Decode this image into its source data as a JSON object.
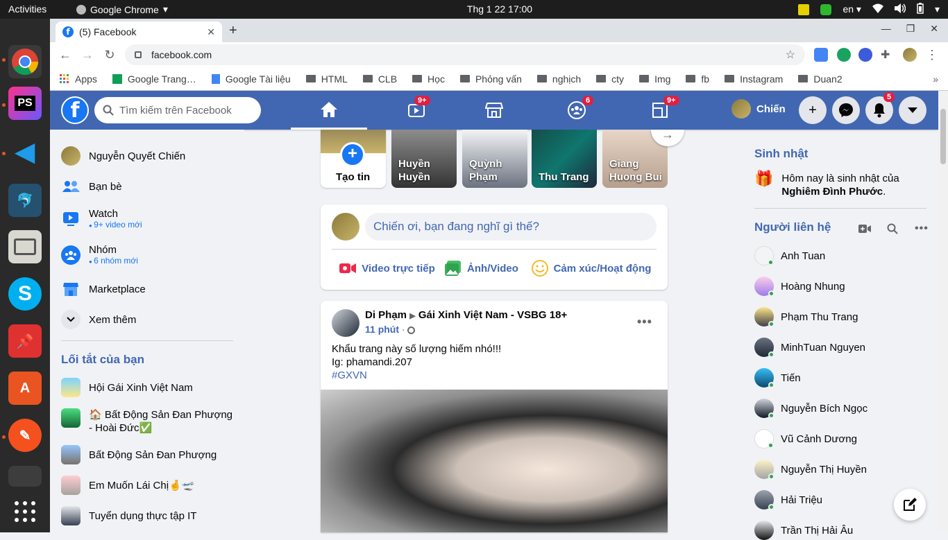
{
  "gnome": {
    "activities": "Activities",
    "app": "Google Chrome",
    "clock": "Thg 1 22  17:00",
    "lang": "en"
  },
  "browser": {
    "tab_title": "(5) Facebook",
    "url": "facebook.com",
    "bookmarks": [
      "Apps",
      "Google Trang…",
      "Google Tài liệu",
      "HTML",
      "CLB",
      "Học",
      "Phỏng vấn",
      "nghịch",
      "cty",
      "Img",
      "fb",
      "Instagram",
      "Duan2"
    ]
  },
  "fb": {
    "search_placeholder": "Tìm kiếm trên Facebook",
    "badges": {
      "watch": "9+",
      "groups": "6",
      "gaming": "9+",
      "notifications": "5"
    },
    "profile_name": "Chiến",
    "left": {
      "user": "Nguyễn Quyết Chiến",
      "friends": "Bạn bè",
      "watch": "Watch",
      "watch_sub": "9+ video mới",
      "groups": "Nhóm",
      "groups_sub": "6 nhóm mới",
      "marketplace": "Marketplace",
      "more": "Xem thêm",
      "shortcuts_title": "Lối tắt của bạn",
      "shortcuts": [
        "Hội Gái Xinh Việt Nam",
        "🏠 Bất Động Sản Đan Phượng - Hoài Đức✅",
        "Bất Động Sản Đan Phượng",
        "Em Muốn Lái Chị🤞🛫",
        "Tuyển dụng thực tập IT"
      ]
    },
    "stories": {
      "create": "Tạo tin",
      "names": [
        "Huyền Huyền",
        "Quỳnh Phạm",
        "Thu Trang",
        "Giang Huong Bui"
      ]
    },
    "composer": {
      "placeholder": "Chiến ơi, bạn đang nghĩ gì thế?",
      "live": "Video trực tiếp",
      "photo": "Ảnh/Video",
      "feeling": "Cảm xúc/Hoạt động"
    },
    "post": {
      "author": "Di Phạm",
      "group": "Gái Xinh Việt Nam - VSBG 18+",
      "time": "11 phút",
      "line1": "Khẩu trang này số lượng hiếm nhó!!!",
      "line2": "Ig: phamandi.207",
      "hashtag": "#GXVN"
    },
    "right": {
      "birthday_title": "Sinh nhật",
      "birthday_text": "Hôm nay là sinh nhật của",
      "birthday_name": "Nghiêm Đình Phước",
      "contacts_title": "Người liên hệ",
      "contacts": [
        "Anh Tuan",
        "Hoàng Nhung",
        "Phạm Thu Trang",
        "MinhTuan Nguyen",
        "Tiến",
        "Nguyễn Bích Ngọc",
        "Vũ Cảnh Dương",
        "Nguyễn Thị Huyền",
        "Hải Triệu",
        "Trần Thị Hải Âu"
      ]
    }
  }
}
